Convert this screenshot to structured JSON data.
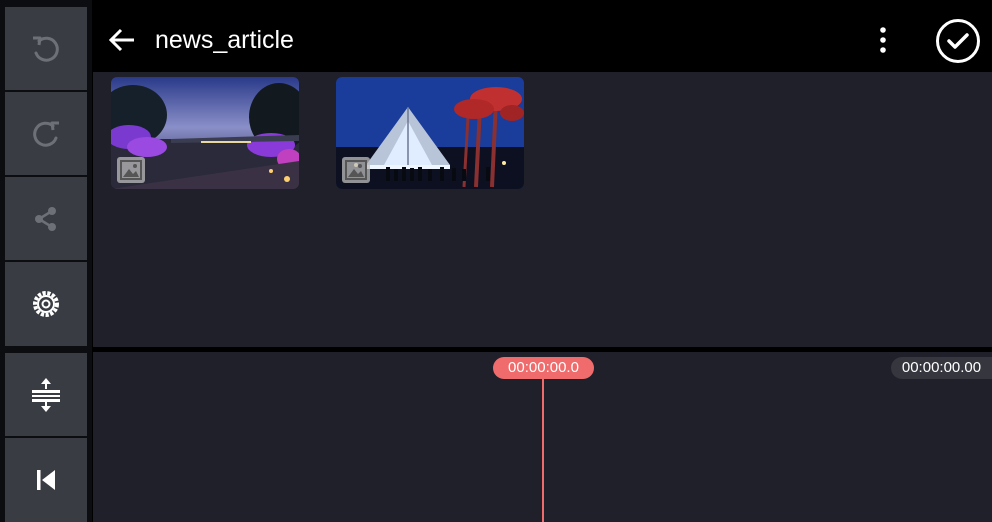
{
  "header": {
    "title": "news_article"
  },
  "sidebar": {
    "buttons": [
      "undo-icon",
      "redo-icon",
      "share-icon",
      "settings-icon"
    ],
    "timeline_buttons": [
      "expand-timeline-icon",
      "skip-to-start-icon"
    ]
  },
  "media": {
    "items": [
      {
        "type": "image",
        "icon": "image-icon"
      },
      {
        "type": "image",
        "icon": "image-icon"
      }
    ]
  },
  "timeline": {
    "playhead_time": "00:00:00.0",
    "total_time": "00:00:00.00"
  },
  "colors": {
    "accent": "#f06b6b",
    "panel": "#1f2029",
    "sidebar_button": "#3a3c44"
  }
}
